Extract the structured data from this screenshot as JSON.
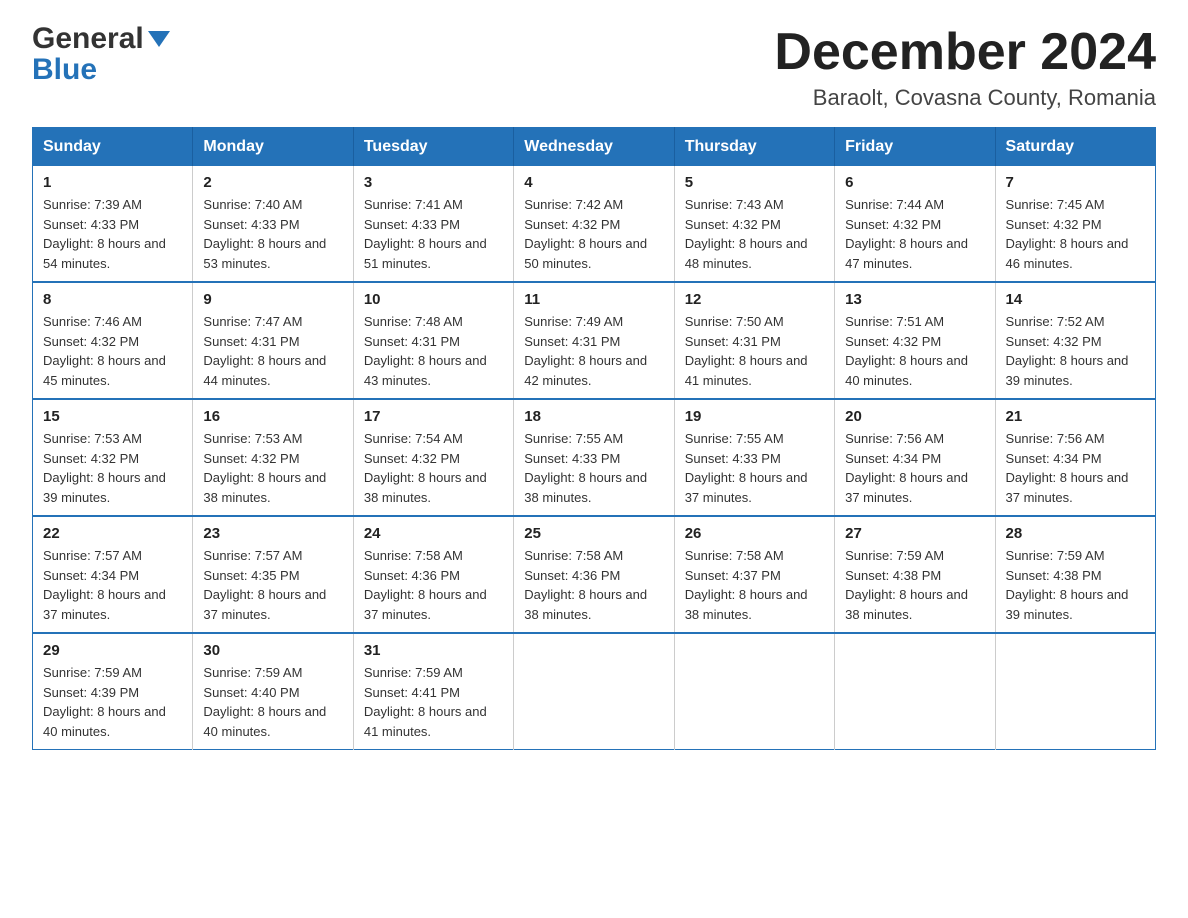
{
  "logo": {
    "line1": "General",
    "line2": "Blue"
  },
  "title": "December 2024",
  "subtitle": "Baraolt, Covasna County, Romania",
  "days": [
    "Sunday",
    "Monday",
    "Tuesday",
    "Wednesday",
    "Thursday",
    "Friday",
    "Saturday"
  ],
  "weeks": [
    [
      {
        "day": "1",
        "sunrise": "7:39 AM",
        "sunset": "4:33 PM",
        "daylight": "8 hours and 54 minutes."
      },
      {
        "day": "2",
        "sunrise": "7:40 AM",
        "sunset": "4:33 PM",
        "daylight": "8 hours and 53 minutes."
      },
      {
        "day": "3",
        "sunrise": "7:41 AM",
        "sunset": "4:33 PM",
        "daylight": "8 hours and 51 minutes."
      },
      {
        "day": "4",
        "sunrise": "7:42 AM",
        "sunset": "4:32 PM",
        "daylight": "8 hours and 50 minutes."
      },
      {
        "day": "5",
        "sunrise": "7:43 AM",
        "sunset": "4:32 PM",
        "daylight": "8 hours and 48 minutes."
      },
      {
        "day": "6",
        "sunrise": "7:44 AM",
        "sunset": "4:32 PM",
        "daylight": "8 hours and 47 minutes."
      },
      {
        "day": "7",
        "sunrise": "7:45 AM",
        "sunset": "4:32 PM",
        "daylight": "8 hours and 46 minutes."
      }
    ],
    [
      {
        "day": "8",
        "sunrise": "7:46 AM",
        "sunset": "4:32 PM",
        "daylight": "8 hours and 45 minutes."
      },
      {
        "day": "9",
        "sunrise": "7:47 AM",
        "sunset": "4:31 PM",
        "daylight": "8 hours and 44 minutes."
      },
      {
        "day": "10",
        "sunrise": "7:48 AM",
        "sunset": "4:31 PM",
        "daylight": "8 hours and 43 minutes."
      },
      {
        "day": "11",
        "sunrise": "7:49 AM",
        "sunset": "4:31 PM",
        "daylight": "8 hours and 42 minutes."
      },
      {
        "day": "12",
        "sunrise": "7:50 AM",
        "sunset": "4:31 PM",
        "daylight": "8 hours and 41 minutes."
      },
      {
        "day": "13",
        "sunrise": "7:51 AM",
        "sunset": "4:32 PM",
        "daylight": "8 hours and 40 minutes."
      },
      {
        "day": "14",
        "sunrise": "7:52 AM",
        "sunset": "4:32 PM",
        "daylight": "8 hours and 39 minutes."
      }
    ],
    [
      {
        "day": "15",
        "sunrise": "7:53 AM",
        "sunset": "4:32 PM",
        "daylight": "8 hours and 39 minutes."
      },
      {
        "day": "16",
        "sunrise": "7:53 AM",
        "sunset": "4:32 PM",
        "daylight": "8 hours and 38 minutes."
      },
      {
        "day": "17",
        "sunrise": "7:54 AM",
        "sunset": "4:32 PM",
        "daylight": "8 hours and 38 minutes."
      },
      {
        "day": "18",
        "sunrise": "7:55 AM",
        "sunset": "4:33 PM",
        "daylight": "8 hours and 38 minutes."
      },
      {
        "day": "19",
        "sunrise": "7:55 AM",
        "sunset": "4:33 PM",
        "daylight": "8 hours and 37 minutes."
      },
      {
        "day": "20",
        "sunrise": "7:56 AM",
        "sunset": "4:34 PM",
        "daylight": "8 hours and 37 minutes."
      },
      {
        "day": "21",
        "sunrise": "7:56 AM",
        "sunset": "4:34 PM",
        "daylight": "8 hours and 37 minutes."
      }
    ],
    [
      {
        "day": "22",
        "sunrise": "7:57 AM",
        "sunset": "4:34 PM",
        "daylight": "8 hours and 37 minutes."
      },
      {
        "day": "23",
        "sunrise": "7:57 AM",
        "sunset": "4:35 PM",
        "daylight": "8 hours and 37 minutes."
      },
      {
        "day": "24",
        "sunrise": "7:58 AM",
        "sunset": "4:36 PM",
        "daylight": "8 hours and 37 minutes."
      },
      {
        "day": "25",
        "sunrise": "7:58 AM",
        "sunset": "4:36 PM",
        "daylight": "8 hours and 38 minutes."
      },
      {
        "day": "26",
        "sunrise": "7:58 AM",
        "sunset": "4:37 PM",
        "daylight": "8 hours and 38 minutes."
      },
      {
        "day": "27",
        "sunrise": "7:59 AM",
        "sunset": "4:38 PM",
        "daylight": "8 hours and 38 minutes."
      },
      {
        "day": "28",
        "sunrise": "7:59 AM",
        "sunset": "4:38 PM",
        "daylight": "8 hours and 39 minutes."
      }
    ],
    [
      {
        "day": "29",
        "sunrise": "7:59 AM",
        "sunset": "4:39 PM",
        "daylight": "8 hours and 40 minutes."
      },
      {
        "day": "30",
        "sunrise": "7:59 AM",
        "sunset": "4:40 PM",
        "daylight": "8 hours and 40 minutes."
      },
      {
        "day": "31",
        "sunrise": "7:59 AM",
        "sunset": "4:41 PM",
        "daylight": "8 hours and 41 minutes."
      },
      null,
      null,
      null,
      null
    ]
  ]
}
